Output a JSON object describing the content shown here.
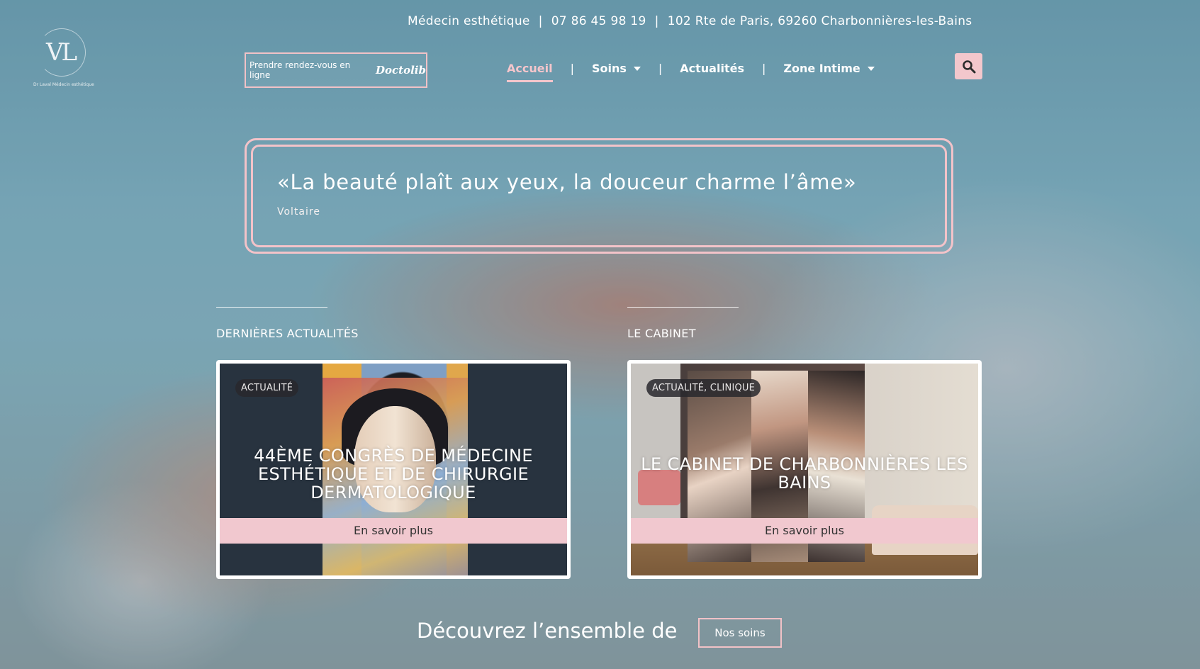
{
  "topbar": {
    "profession": "Médecin esthétique",
    "phone": "07 86 45 98 19",
    "address": "102 Rte de Paris, 69260 Charbonnières-les-Bains",
    "separator": "|"
  },
  "logo": {
    "monogram": "VL",
    "subtitle": "Dr Laval Médecin esthétique"
  },
  "booking": {
    "label": "Prendre rendez-vous en ligne",
    "brand": "Doctolib"
  },
  "nav": {
    "items": [
      {
        "label": "Accueil",
        "active": true
      },
      {
        "label": "Soins",
        "dropdown": true
      },
      {
        "label": "Actualités"
      },
      {
        "label": "Zone Intime",
        "dropdown": true
      }
    ],
    "separator": "|"
  },
  "search": {
    "icon": "search-icon",
    "accent": "#f3c7cc"
  },
  "quote": {
    "text": "«La beauté plaît aux yeux, la douceur charme l’âme»",
    "author": "Voltaire"
  },
  "sections": {
    "news": {
      "title": "DERNIÈRES ACTUALITÉS",
      "card": {
        "badge": "ACTUALITÉ",
        "title": "44ÈME CONGRÈS DE MÉDECINE ESTHÉTIQUE ET DE CHIRURGIE DERMATOLOGIQUE",
        "button": "En savoir plus"
      }
    },
    "cabinet": {
      "title": "LE CABINET",
      "card": {
        "badge": "ACTUALITÉ, CLINIQUE",
        "title": "LE CABINET DE CHARBONNIÈRES LES BAINS",
        "button": "En savoir plus"
      }
    }
  },
  "footer_cta": {
    "text": "Découvrez l’ensemble de",
    "button": "Nos soins"
  },
  "colors": {
    "accent_pink": "#f3c3c9",
    "button_pink": "#f1c8cf"
  }
}
